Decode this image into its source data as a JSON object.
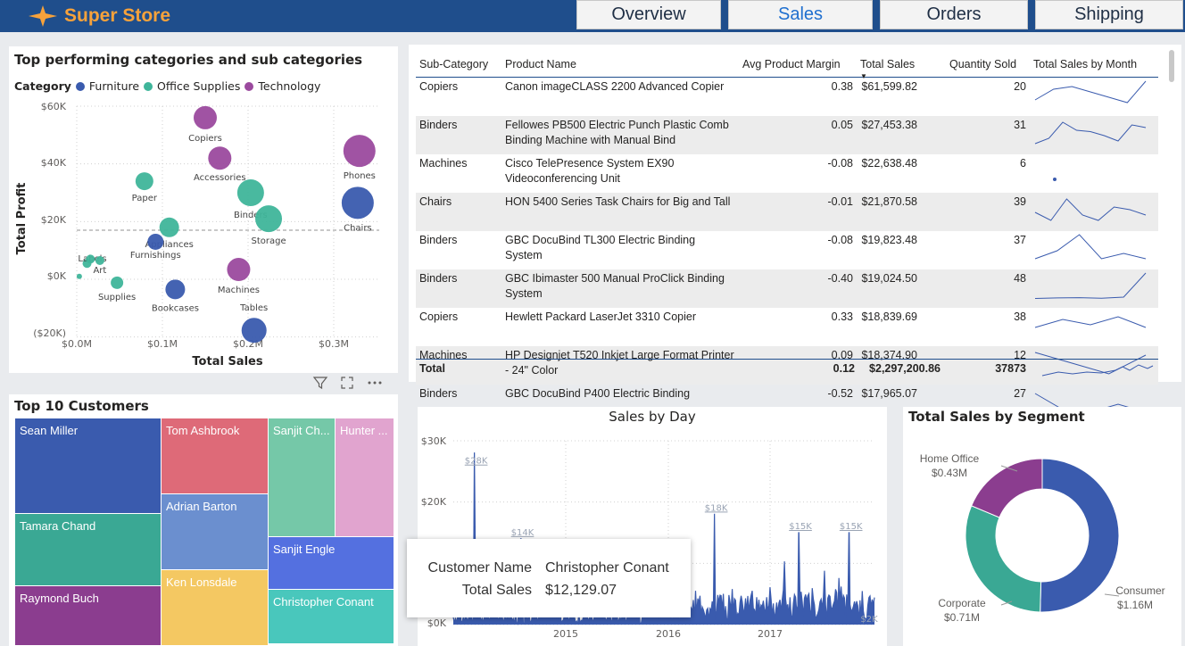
{
  "app": {
    "title": "Super Store"
  },
  "nav": {
    "tabs": [
      {
        "label": "Overview"
      },
      {
        "label": "Sales"
      },
      {
        "label": "Orders"
      },
      {
        "label": "Shipping"
      }
    ],
    "active": "Sales"
  },
  "scatter": {
    "title": "Top performing categories and sub categories",
    "legend_title": "Category",
    "legend": [
      {
        "name": "Furniture",
        "color": "#3a5bae"
      },
      {
        "name": "Office Supplies",
        "color": "#3fb59a"
      },
      {
        "name": "Technology",
        "color": "#9b4a9e"
      }
    ],
    "xlabel": "Total Sales",
    "ylabel": "Total Profit",
    "xticks": [
      "$0.0M",
      "$0.1M",
      "$0.2M",
      "$0.3M"
    ],
    "yticks": [
      "$60K",
      "$40K",
      "$20K",
      "$0K",
      "($20K)"
    ]
  },
  "chart_data": [
    {
      "type": "scatter",
      "title": "Top performing categories and sub categories",
      "xlabel": "Total Sales",
      "ylabel": "Total Profit",
      "xlim": [
        0,
        350000
      ],
      "ylim": [
        -20000,
        62000
      ],
      "reference_line_y": 17000,
      "points": [
        {
          "label": "Copiers",
          "category": "Technology",
          "x": 150000,
          "y": 56000,
          "size": 13
        },
        {
          "label": "Accessories",
          "category": "Technology",
          "x": 167000,
          "y": 42000,
          "size": 13
        },
        {
          "label": "Phones",
          "category": "Technology",
          "x": 330000,
          "y": 44500,
          "size": 18
        },
        {
          "label": "Chairs",
          "category": "Furniture",
          "x": 328000,
          "y": 26500,
          "size": 18
        },
        {
          "label": "Paper",
          "category": "Office Supplies",
          "x": 79000,
          "y": 34000,
          "size": 10
        },
        {
          "label": "Binders",
          "category": "Office Supplies",
          "x": 203000,
          "y": 30000,
          "size": 15
        },
        {
          "label": "Storage",
          "category": "Office Supplies",
          "x": 224000,
          "y": 21000,
          "size": 15
        },
        {
          "label": "Appliances",
          "category": "Office Supplies",
          "x": 108000,
          "y": 18000,
          "size": 11
        },
        {
          "label": "Furnishings",
          "category": "Furniture",
          "x": 92000,
          "y": 13000,
          "size": 9
        },
        {
          "label": "Labels",
          "category": "Office Supplies",
          "x": 12000,
          "y": 5500,
          "size": 5
        },
        {
          "label": "Art",
          "category": "Office Supplies",
          "x": 27000,
          "y": 6500,
          "size": 5
        },
        {
          "label": "Envelopes",
          "category": "Office Supplies",
          "x": 16000,
          "y": 7000,
          "size": 5
        },
        {
          "label": "Fasteners",
          "category": "Office Supplies",
          "x": 3000,
          "y": 1000,
          "size": 3
        },
        {
          "label": "Supplies",
          "category": "Office Supplies",
          "x": 47000,
          "y": -1200,
          "size": 7
        },
        {
          "label": "Machines",
          "category": "Technology",
          "x": 189000,
          "y": 3400,
          "size": 13
        },
        {
          "label": "Bookcases",
          "category": "Furniture",
          "x": 115000,
          "y": -3500,
          "size": 11
        },
        {
          "label": "Tables",
          "category": "Furniture",
          "x": 207000,
          "y": -17700,
          "size": 14
        }
      ]
    },
    {
      "type": "line",
      "title": "Sales by Day",
      "xticks": [
        "2015",
        "2016",
        "2017"
      ],
      "yticks": [
        "$30K",
        "$20K",
        "$10K",
        "$0K"
      ],
      "ylim": [
        0,
        30000
      ],
      "peaks": [
        {
          "t": 0.05,
          "value": 28000,
          "label": "$28K"
        },
        {
          "t": 0.16,
          "value": 14000,
          "label": "$14K"
        },
        {
          "t": 0.62,
          "value": 18000,
          "label": "$18K"
        },
        {
          "t": 0.82,
          "value": 15000,
          "label": "$15K"
        },
        {
          "t": 0.94,
          "value": 15000,
          "label": "$15K"
        }
      ]
    },
    {
      "type": "pie",
      "title": "Total Sales by Segment",
      "slices": [
        {
          "name": "Consumer",
          "value": 1.16,
          "label": "$1.16M",
          "color": "#3a5bae"
        },
        {
          "name": "Corporate",
          "value": 0.71,
          "label": "$0.71M",
          "color": "#3aa894"
        },
        {
          "name": "Home Office",
          "value": 0.43,
          "label": "$0.43M",
          "color": "#8b3d8f"
        }
      ]
    },
    {
      "type": "table",
      "title": "Top 10 Customers (treemap)",
      "items": [
        {
          "name": "Sean Miller"
        },
        {
          "name": "Tamara Chand"
        },
        {
          "name": "Raymond Buch"
        },
        {
          "name": "Tom Ashbrook"
        },
        {
          "name": "Adrian Barton"
        },
        {
          "name": "Ken Lonsdale"
        },
        {
          "name": "Sanjit Ch..."
        },
        {
          "name": "Hunter ..."
        },
        {
          "name": "Sanjit Engle"
        },
        {
          "name": "Christopher Conant"
        }
      ]
    }
  ],
  "table": {
    "headers": [
      "Sub-Category",
      "Product Name",
      "Avg Product Margin",
      "Total Sales",
      "Quantity Sold",
      "Total Sales by Month"
    ],
    "rows": [
      {
        "sub": "Copiers",
        "product": "Canon imageCLASS 2200 Advanced Copier",
        "margin": "0.38",
        "sales": "$61,599.82",
        "qty": "20",
        "spark": [
          0.7,
          0.3,
          0.2,
          0.4,
          0.6,
          0.8,
          0.0
        ]
      },
      {
        "sub": "Binders",
        "product": "Fellowes PB500 Electric Punch Plastic Comb Binding Machine with Manual Bind",
        "margin": "0.05",
        "sales": "$27,453.38",
        "qty": "31",
        "spark": [
          0.9,
          0.7,
          0.1,
          0.4,
          0.45,
          0.6,
          0.8,
          0.2,
          0.3
        ]
      },
      {
        "sub": "Machines",
        "product": "Cisco TelePresence System EX90 Videoconferencing Unit",
        "margin": "-0.08",
        "sales": "$22,638.48",
        "qty": "6",
        "spark": []
      },
      {
        "sub": "Chairs",
        "product": "HON 5400 Series Task Chairs for Big and Tall",
        "margin": "-0.01",
        "sales": "$21,870.58",
        "qty": "39",
        "spark": [
          0.6,
          0.9,
          0.1,
          0.7,
          0.9,
          0.4,
          0.5,
          0.7
        ]
      },
      {
        "sub": "Binders",
        "product": "GBC DocuBind TL300 Electric Binding System",
        "margin": "-0.08",
        "sales": "$19,823.48",
        "qty": "37",
        "spark": [
          0.9,
          0.6,
          0.0,
          0.9,
          0.7,
          0.9
        ]
      },
      {
        "sub": "Binders",
        "product": "GBC Ibimaster 500 Manual ProClick Binding System",
        "margin": "-0.40",
        "sales": "$19,024.50",
        "qty": "48",
        "spark": [
          0.95,
          0.93,
          0.92,
          0.94,
          0.9,
          0.0
        ]
      },
      {
        "sub": "Copiers",
        "product": "Hewlett Packard LaserJet 3310 Copier",
        "margin": "0.33",
        "sales": "$18,839.69",
        "qty": "38",
        "spark": [
          0.6,
          0.3,
          0.5,
          0.2,
          0.6
        ]
      },
      {
        "sub": "Machines",
        "product": "HP Designjet T520 Inkjet Large Format Printer - 24\" Color",
        "margin": "0.09",
        "sales": "$18,374.90",
        "qty": "12",
        "spark": [
          0.1,
          0.5,
          0.9,
          0.2
        ]
      },
      {
        "sub": "Binders",
        "product": "GBC DocuBind P400 Electric Binding",
        "margin": "-0.52",
        "sales": "$17,965.07",
        "qty": "27",
        "spark": [
          0.2,
          0.8,
          0.9,
          0.6,
          0.9
        ]
      }
    ],
    "total": {
      "label": "Total",
      "margin": "0.12",
      "sales": "$2,297,200.86",
      "qty": "37873"
    }
  },
  "customers": {
    "title": "Top 10 Customers"
  },
  "tooltip": {
    "k1": "Customer Name",
    "v1": "Christopher Conant",
    "k2": "Total Sales",
    "v2": "$12,129.07"
  },
  "sales_day": {
    "title": "Sales by Day",
    "xticks": [
      "2015",
      "2016",
      "2017"
    ],
    "yticks": [
      "$30K",
      "$20K",
      "$0K"
    ],
    "peak_labels": [
      "$28K",
      "$14K",
      "$18K",
      "$15K",
      "$15K"
    ],
    "end_label": "$2K",
    "start_label": "$0K"
  },
  "segment": {
    "title": "Total Sales by Segment",
    "home_office": "Home Office",
    "home_office_val": "$0.43M",
    "corporate": "Corporate",
    "corporate_val": "$0.71M",
    "consumer": "Consumer",
    "consumer_val": "$1.16M"
  }
}
